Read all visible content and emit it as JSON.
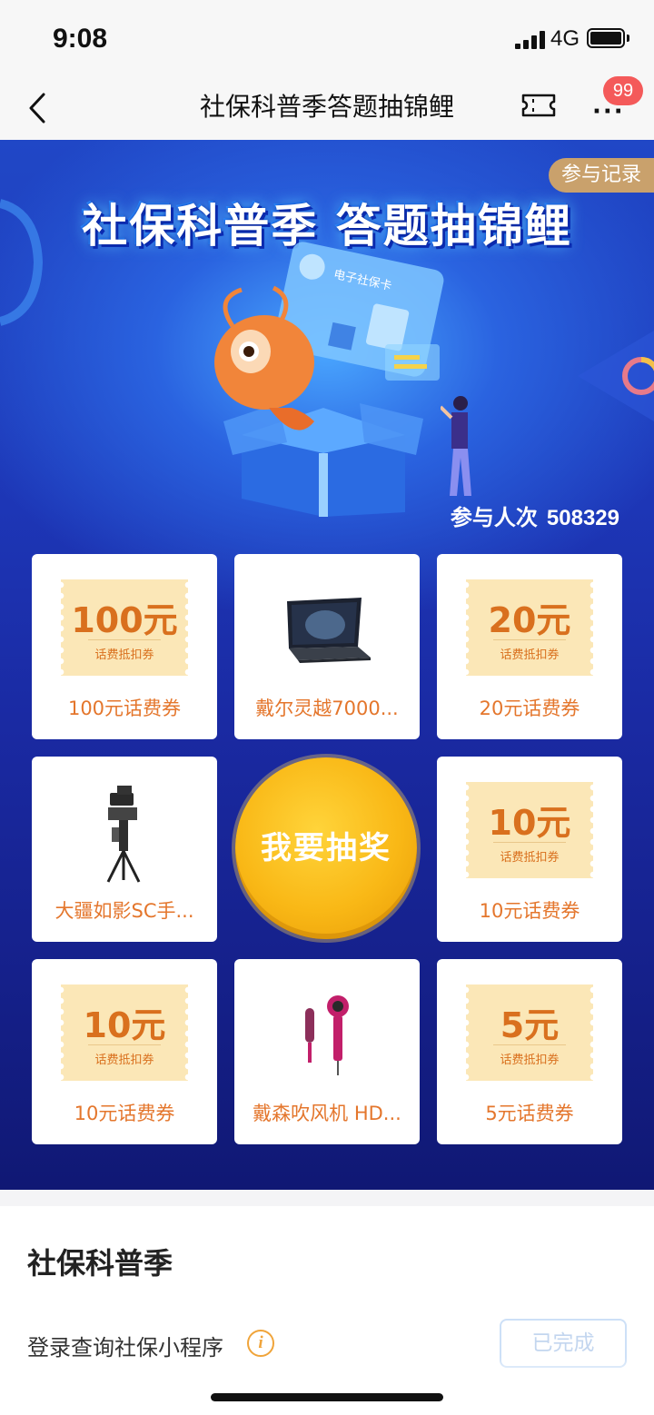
{
  "status_bar": {
    "time": "9:08",
    "network": "4G"
  },
  "nav": {
    "title": "社保科普季答题抽锦鲤",
    "badge_count": "99"
  },
  "banner": {
    "title": "社保科普季  答题抽锦鲤",
    "card_text": "电子社保卡",
    "record_button": "参与记录",
    "participants_label": "参与人次",
    "participants_count": "508329"
  },
  "prizes": [
    {
      "type": "coupon",
      "amount": "100元",
      "sub": "话费抵扣券",
      "name": "100元话费券"
    },
    {
      "type": "image",
      "icon": "laptop-icon",
      "name": "戴尔灵越7000..."
    },
    {
      "type": "coupon",
      "amount": "20元",
      "sub": "话费抵扣券",
      "name": "20元话费券"
    },
    {
      "type": "image",
      "icon": "gimbal-icon",
      "name": "大疆如影SC手..."
    },
    {
      "type": "coupon",
      "amount": "10元",
      "sub": "话费抵扣券",
      "name": "10元话费券"
    },
    {
      "type": "coupon",
      "amount": "10元",
      "sub": "话费抵扣券",
      "name": "10元话费券"
    },
    {
      "type": "image",
      "icon": "hair-dryer-icon",
      "name": "戴森吹风机 HD..."
    },
    {
      "type": "coupon",
      "amount": "5元",
      "sub": "话费抵扣券",
      "name": "5元话费券"
    }
  ],
  "draw_button": "我要抽奖",
  "section": {
    "title": "社保科普季",
    "task_label": "登录查询社保小程序",
    "task_status": "已完成"
  },
  "colors": {
    "accent_orange": "#e4762c",
    "coupon_bg": "#fbe7b7",
    "draw_gold": "#f9b816",
    "banner_blue": "#1d36b6",
    "badge_red": "#f45a5a"
  }
}
